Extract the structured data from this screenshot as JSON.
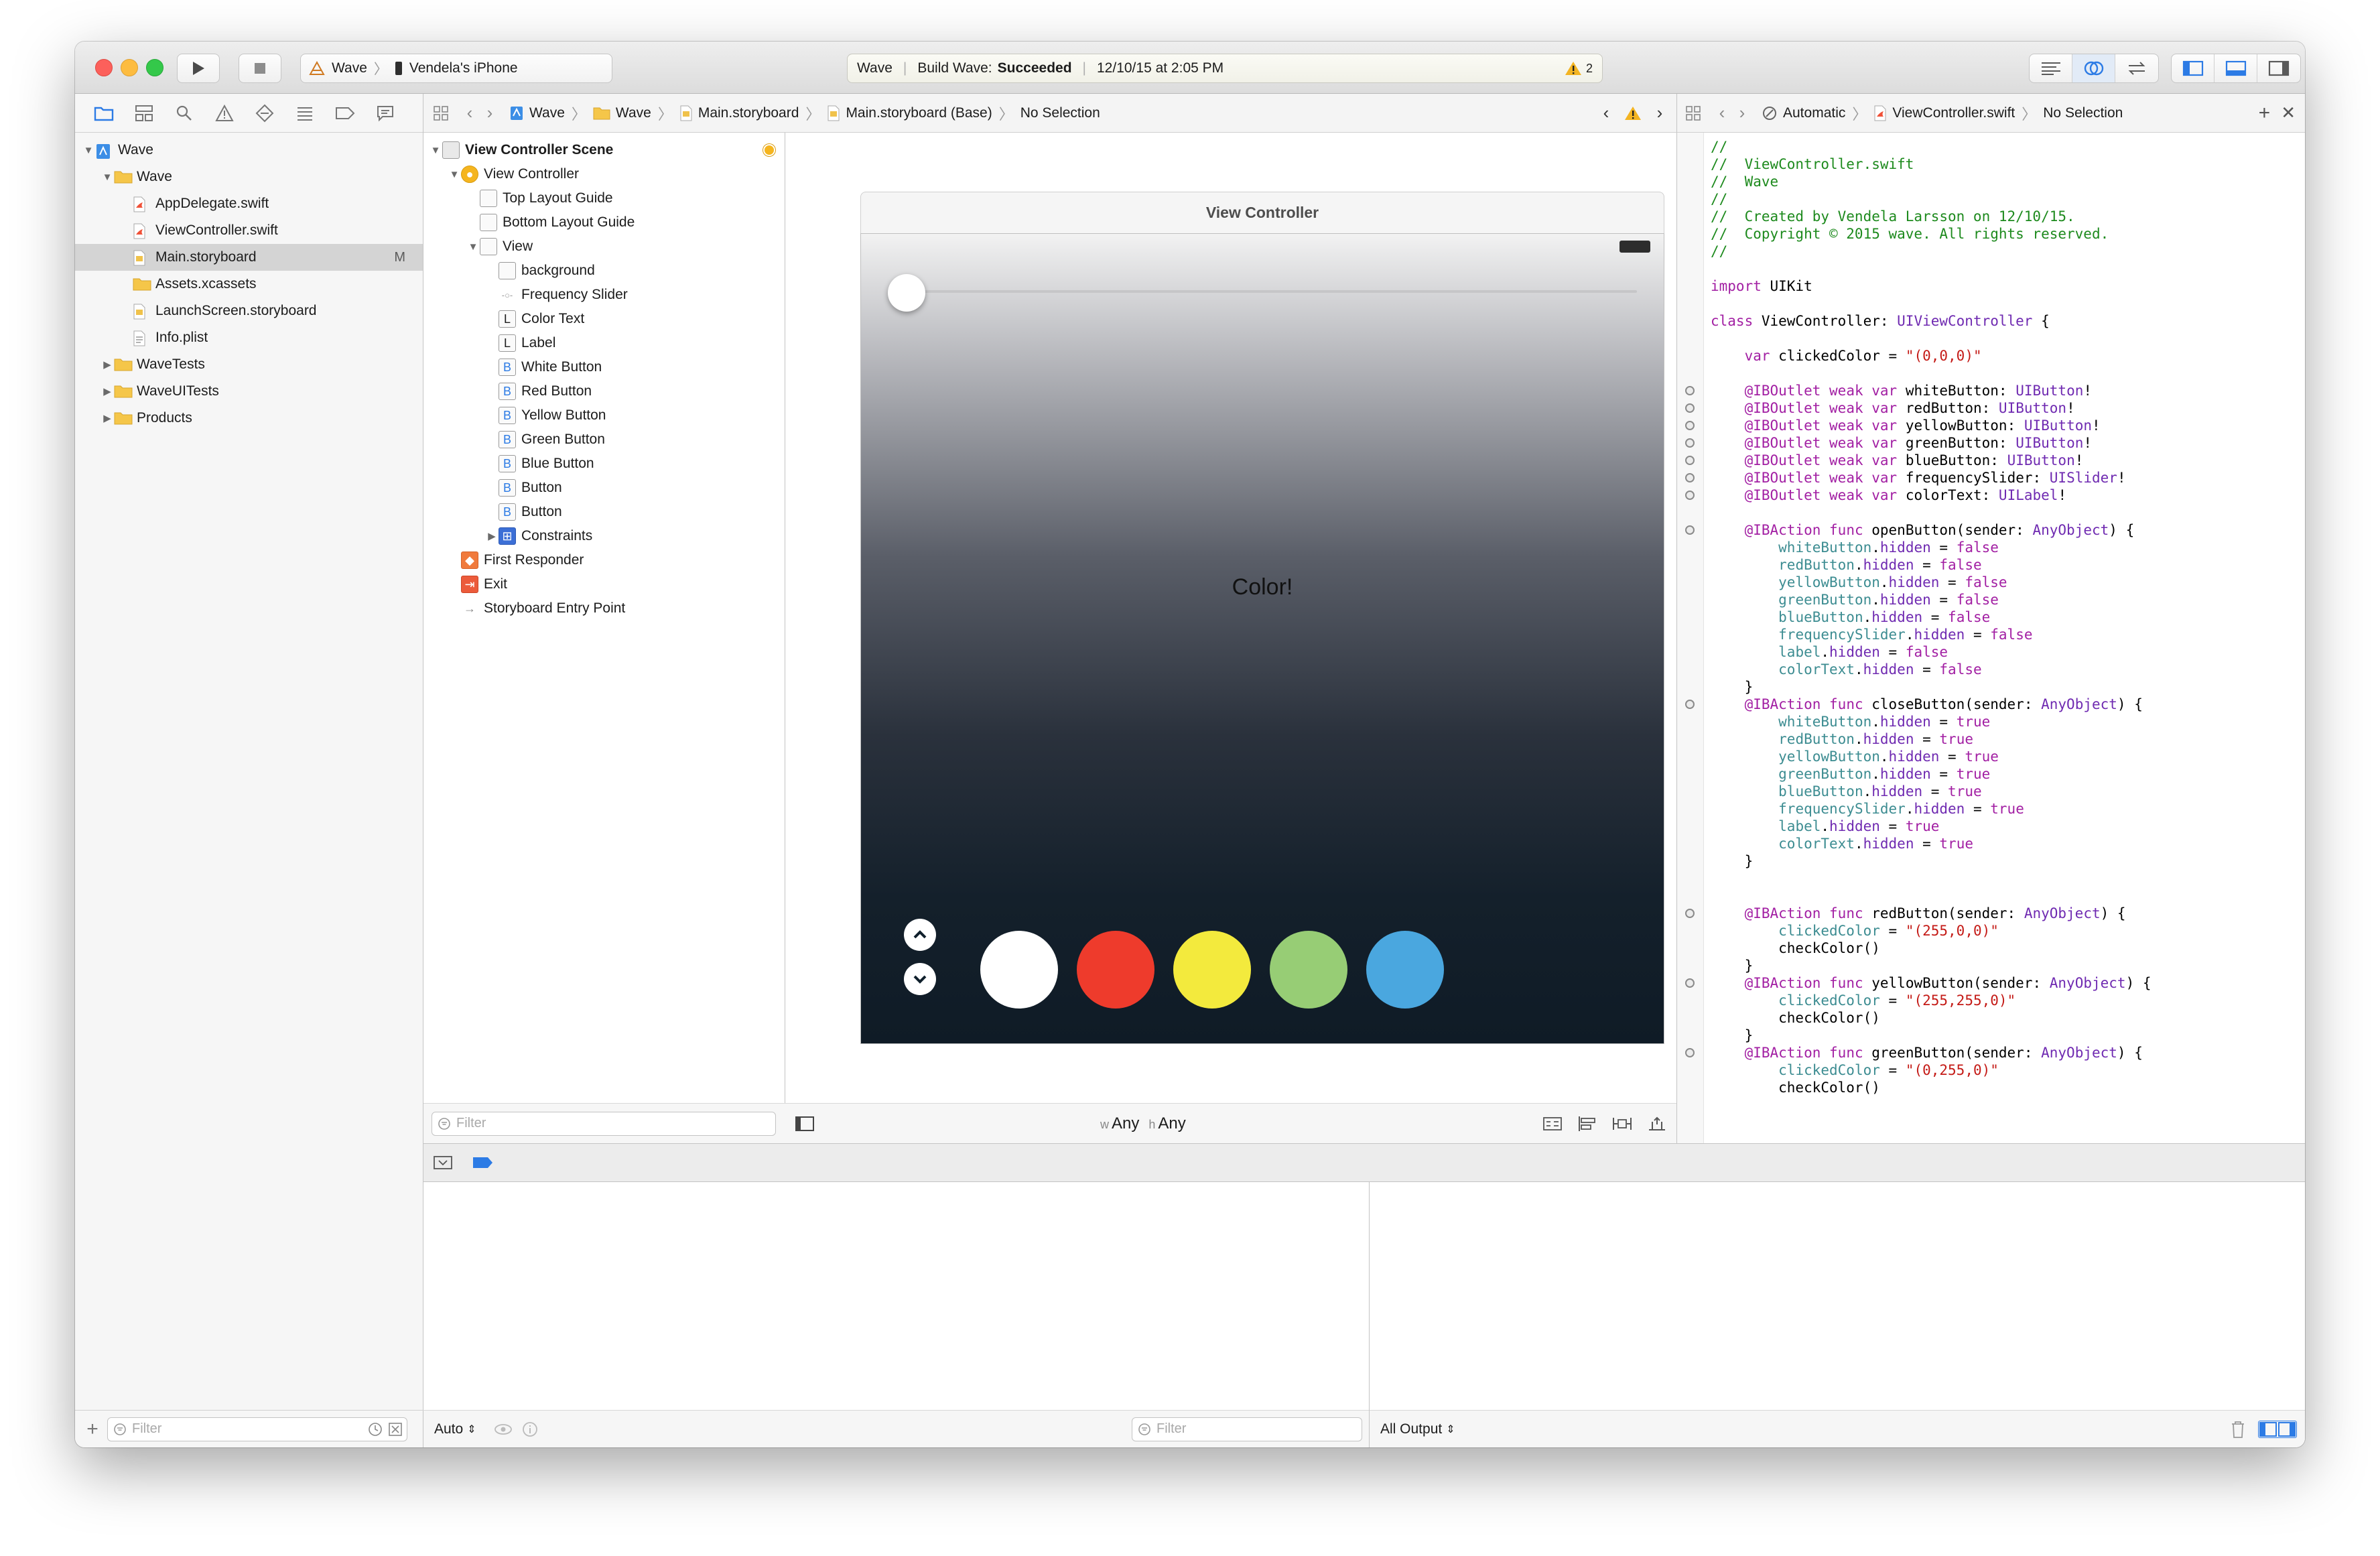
{
  "toolbar": {
    "scheme_project": "Wave",
    "scheme_device": "Vendela's iPhone",
    "activity_target": "Wave",
    "activity_status_prefix": "Build Wave:",
    "activity_status_result": "Succeeded",
    "activity_timestamp": "12/10/15 at 2:05 PM",
    "warning_count": "2"
  },
  "navigator": {
    "items": [
      {
        "label": "Wave",
        "indent": 0,
        "disclosure": "▼",
        "icon": "project-icon"
      },
      {
        "label": "Wave",
        "indent": 1,
        "disclosure": "▼",
        "icon": "folder-icon"
      },
      {
        "label": "AppDelegate.swift",
        "indent": 2,
        "disclosure": "",
        "icon": "swift-file-icon"
      },
      {
        "label": "ViewController.swift",
        "indent": 2,
        "disclosure": "",
        "icon": "swift-file-icon"
      },
      {
        "label": "Main.storyboard",
        "indent": 2,
        "disclosure": "",
        "icon": "storyboard-file-icon",
        "badge": "M",
        "selected": true
      },
      {
        "label": "Assets.xcassets",
        "indent": 2,
        "disclosure": "",
        "icon": "folder-icon"
      },
      {
        "label": "LaunchScreen.storyboard",
        "indent": 2,
        "disclosure": "",
        "icon": "storyboard-file-icon"
      },
      {
        "label": "Info.plist",
        "indent": 2,
        "disclosure": "",
        "icon": "plist-file-icon"
      },
      {
        "label": "WaveTests",
        "indent": 1,
        "disclosure": "▶",
        "icon": "folder-icon"
      },
      {
        "label": "WaveUITests",
        "indent": 1,
        "disclosure": "▶",
        "icon": "folder-icon"
      },
      {
        "label": "Products",
        "indent": 1,
        "disclosure": "▶",
        "icon": "folder-icon"
      }
    ],
    "filter_placeholder": "Filter"
  },
  "ib_jumpbar": {
    "crumbs": [
      "Wave",
      "Wave",
      "Main.storyboard",
      "Main.storyboard (Base)",
      "No Selection"
    ]
  },
  "editor_jumpbar": {
    "crumbs": [
      "Automatic",
      "ViewController.swift",
      "No Selection"
    ]
  },
  "outline": {
    "items": [
      {
        "label": "View Controller Scene",
        "indent": 0,
        "disclosure": "▼",
        "glyph": "",
        "bold": true
      },
      {
        "label": "View Controller",
        "indent": 1,
        "disclosure": "▼",
        "glyph": "●",
        "kind": "vc"
      },
      {
        "label": "Top Layout Guide",
        "indent": 2,
        "disclosure": "",
        "glyph": ""
      },
      {
        "label": "Bottom Layout Guide",
        "indent": 2,
        "disclosure": "",
        "glyph": ""
      },
      {
        "label": "View",
        "indent": 2,
        "disclosure": "▼",
        "glyph": ""
      },
      {
        "label": "background",
        "indent": 3,
        "disclosure": "",
        "glyph": ""
      },
      {
        "label": "Frequency Slider",
        "indent": 3,
        "disclosure": "",
        "glyph": "-○-"
      },
      {
        "label": "Color Text",
        "indent": 3,
        "disclosure": "",
        "glyph": "L"
      },
      {
        "label": "Label",
        "indent": 3,
        "disclosure": "",
        "glyph": "L"
      },
      {
        "label": "White Button",
        "indent": 3,
        "disclosure": "",
        "glyph": "B"
      },
      {
        "label": "Red Button",
        "indent": 3,
        "disclosure": "",
        "glyph": "B"
      },
      {
        "label": "Yellow Button",
        "indent": 3,
        "disclosure": "",
        "glyph": "B"
      },
      {
        "label": "Green Button",
        "indent": 3,
        "disclosure": "",
        "glyph": "B"
      },
      {
        "label": "Blue Button",
        "indent": 3,
        "disclosure": "",
        "glyph": "B"
      },
      {
        "label": "Button",
        "indent": 3,
        "disclosure": "",
        "glyph": "B"
      },
      {
        "label": "Button",
        "indent": 3,
        "disclosure": "",
        "glyph": "B"
      },
      {
        "label": "Constraints",
        "indent": 3,
        "disclosure": "▶",
        "glyph": "⊞",
        "kind": "constraints"
      },
      {
        "label": "First Responder",
        "indent": 1,
        "disclosure": "",
        "glyph": "◆",
        "kind": "responder"
      },
      {
        "label": "Exit",
        "indent": 1,
        "disclosure": "",
        "glyph": "⇥",
        "kind": "exit"
      },
      {
        "label": "Storyboard Entry Point",
        "indent": 1,
        "disclosure": "",
        "glyph": "→",
        "kind": "entry"
      }
    ],
    "filter_placeholder": "Filter"
  },
  "canvas": {
    "scene_title": "View Controller",
    "center_label": "Color!",
    "size_class_w_prefix": "w",
    "size_class_w": "Any",
    "size_class_h_prefix": "h",
    "size_class_h": "Any",
    "color_buttons": [
      {
        "name": "white",
        "color": "#ffffff"
      },
      {
        "name": "red",
        "color": "#ee3b2c"
      },
      {
        "name": "yellow",
        "color": "#f3ea3d"
      },
      {
        "name": "green",
        "color": "#97cd75"
      },
      {
        "name": "blue",
        "color": "#4aa7df"
      }
    ]
  },
  "code_lines": [
    [
      [
        "//",
        "comment"
      ]
    ],
    [
      [
        "//  ViewController.swift",
        "comment"
      ]
    ],
    [
      [
        "//  Wave",
        "comment"
      ]
    ],
    [
      [
        "//",
        "comment"
      ]
    ],
    [
      [
        "//  Created by Vendela Larsson on 12/10/15.",
        "comment"
      ]
    ],
    [
      [
        "//  Copyright © 2015 wave. All rights reserved.",
        "comment"
      ]
    ],
    [
      [
        "//",
        "comment"
      ]
    ],
    [],
    [
      [
        "import",
        "kw"
      ],
      [
        " UIKit",
        ""
      ]
    ],
    [],
    [
      [
        "class",
        "kw"
      ],
      [
        " ViewController: ",
        ""
      ],
      [
        "UIViewController",
        "type"
      ],
      [
        " {",
        ""
      ]
    ],
    [],
    [
      [
        "    ",
        ""
      ],
      [
        "var",
        "kw"
      ],
      [
        " clickedColor = ",
        ""
      ],
      [
        "\"(0,0,0)\"",
        "str"
      ]
    ],
    [],
    [
      [
        "    ",
        ""
      ],
      [
        "@IBOutlet",
        "kw"
      ],
      [
        " ",
        ""
      ],
      [
        "weak",
        "kw"
      ],
      [
        " ",
        ""
      ],
      [
        "var",
        "kw"
      ],
      [
        " whiteButton: ",
        ""
      ],
      [
        "UIButton",
        "type"
      ],
      [
        "!",
        ""
      ]
    ],
    [
      [
        "    ",
        ""
      ],
      [
        "@IBOutlet",
        "kw"
      ],
      [
        " ",
        ""
      ],
      [
        "weak",
        "kw"
      ],
      [
        " ",
        ""
      ],
      [
        "var",
        "kw"
      ],
      [
        " redButton: ",
        ""
      ],
      [
        "UIButton",
        "type"
      ],
      [
        "!",
        ""
      ]
    ],
    [
      [
        "    ",
        ""
      ],
      [
        "@IBOutlet",
        "kw"
      ],
      [
        " ",
        ""
      ],
      [
        "weak",
        "kw"
      ],
      [
        " ",
        ""
      ],
      [
        "var",
        "kw"
      ],
      [
        " yellowButton: ",
        ""
      ],
      [
        "UIButton",
        "type"
      ],
      [
        "!",
        ""
      ]
    ],
    [
      [
        "    ",
        ""
      ],
      [
        "@IBOutlet",
        "kw"
      ],
      [
        " ",
        ""
      ],
      [
        "weak",
        "kw"
      ],
      [
        " ",
        ""
      ],
      [
        "var",
        "kw"
      ],
      [
        " greenButton: ",
        ""
      ],
      [
        "UIButton",
        "type"
      ],
      [
        "!",
        ""
      ]
    ],
    [
      [
        "    ",
        ""
      ],
      [
        "@IBOutlet",
        "kw"
      ],
      [
        " ",
        ""
      ],
      [
        "weak",
        "kw"
      ],
      [
        " ",
        ""
      ],
      [
        "var",
        "kw"
      ],
      [
        " blueButton: ",
        ""
      ],
      [
        "UIButton",
        "type"
      ],
      [
        "!",
        ""
      ]
    ],
    [
      [
        "    ",
        ""
      ],
      [
        "@IBOutlet",
        "kw"
      ],
      [
        " ",
        ""
      ],
      [
        "weak",
        "kw"
      ],
      [
        " ",
        ""
      ],
      [
        "var",
        "kw"
      ],
      [
        " frequencySlider: ",
        ""
      ],
      [
        "UISlider",
        "type"
      ],
      [
        "!",
        ""
      ]
    ],
    [
      [
        "    ",
        ""
      ],
      [
        "@IBOutlet",
        "kw"
      ],
      [
        " ",
        ""
      ],
      [
        "weak",
        "kw"
      ],
      [
        " ",
        ""
      ],
      [
        "var",
        "kw"
      ],
      [
        " colorText: ",
        ""
      ],
      [
        "UILabel",
        "type"
      ],
      [
        "!",
        ""
      ]
    ],
    [],
    [
      [
        "    ",
        ""
      ],
      [
        "@IBAction",
        "kw"
      ],
      [
        " ",
        ""
      ],
      [
        "func",
        "kw"
      ],
      [
        " openButton(sender: ",
        ""
      ],
      [
        "AnyObject",
        "type"
      ],
      [
        ") {",
        ""
      ]
    ],
    [
      [
        "        ",
        ""
      ],
      [
        "whiteButton",
        "prop"
      ],
      [
        ".",
        ""
      ],
      [
        "hidden",
        "type"
      ],
      [
        " = ",
        ""
      ],
      [
        "false",
        "kw"
      ]
    ],
    [
      [
        "        ",
        ""
      ],
      [
        "redButton",
        "prop"
      ],
      [
        ".",
        ""
      ],
      [
        "hidden",
        "type"
      ],
      [
        " = ",
        ""
      ],
      [
        "false",
        "kw"
      ]
    ],
    [
      [
        "        ",
        ""
      ],
      [
        "yellowButton",
        "prop"
      ],
      [
        ".",
        ""
      ],
      [
        "hidden",
        "type"
      ],
      [
        " = ",
        ""
      ],
      [
        "false",
        "kw"
      ]
    ],
    [
      [
        "        ",
        ""
      ],
      [
        "greenButton",
        "prop"
      ],
      [
        ".",
        ""
      ],
      [
        "hidden",
        "type"
      ],
      [
        " = ",
        ""
      ],
      [
        "false",
        "kw"
      ]
    ],
    [
      [
        "        ",
        ""
      ],
      [
        "blueButton",
        "prop"
      ],
      [
        ".",
        ""
      ],
      [
        "hidden",
        "type"
      ],
      [
        " = ",
        ""
      ],
      [
        "false",
        "kw"
      ]
    ],
    [
      [
        "        ",
        ""
      ],
      [
        "frequencySlider",
        "prop"
      ],
      [
        ".",
        ""
      ],
      [
        "hidden",
        "type"
      ],
      [
        " = ",
        ""
      ],
      [
        "false",
        "kw"
      ]
    ],
    [
      [
        "        ",
        ""
      ],
      [
        "label",
        "prop"
      ],
      [
        ".",
        ""
      ],
      [
        "hidden",
        "type"
      ],
      [
        " = ",
        ""
      ],
      [
        "false",
        "kw"
      ]
    ],
    [
      [
        "        ",
        ""
      ],
      [
        "colorText",
        "prop"
      ],
      [
        ".",
        ""
      ],
      [
        "hidden",
        "type"
      ],
      [
        " = ",
        ""
      ],
      [
        "false",
        "kw"
      ]
    ],
    [
      [
        "    }",
        ""
      ]
    ],
    [
      [
        "    ",
        ""
      ],
      [
        "@IBAction",
        "kw"
      ],
      [
        " ",
        ""
      ],
      [
        "func",
        "kw"
      ],
      [
        " closeButton(sender: ",
        ""
      ],
      [
        "AnyObject",
        "type"
      ],
      [
        ") {",
        ""
      ]
    ],
    [
      [
        "        ",
        ""
      ],
      [
        "whiteButton",
        "prop"
      ],
      [
        ".",
        ""
      ],
      [
        "hidden",
        "type"
      ],
      [
        " = ",
        ""
      ],
      [
        "true",
        "kw"
      ]
    ],
    [
      [
        "        ",
        ""
      ],
      [
        "redButton",
        "prop"
      ],
      [
        ".",
        ""
      ],
      [
        "hidden",
        "type"
      ],
      [
        " = ",
        ""
      ],
      [
        "true",
        "kw"
      ]
    ],
    [
      [
        "        ",
        ""
      ],
      [
        "yellowButton",
        "prop"
      ],
      [
        ".",
        ""
      ],
      [
        "hidden",
        "type"
      ],
      [
        " = ",
        ""
      ],
      [
        "true",
        "kw"
      ]
    ],
    [
      [
        "        ",
        ""
      ],
      [
        "greenButton",
        "prop"
      ],
      [
        ".",
        ""
      ],
      [
        "hidden",
        "type"
      ],
      [
        " = ",
        ""
      ],
      [
        "true",
        "kw"
      ]
    ],
    [
      [
        "        ",
        ""
      ],
      [
        "blueButton",
        "prop"
      ],
      [
        ".",
        ""
      ],
      [
        "hidden",
        "type"
      ],
      [
        " = ",
        ""
      ],
      [
        "true",
        "kw"
      ]
    ],
    [
      [
        "        ",
        ""
      ],
      [
        "frequencySlider",
        "prop"
      ],
      [
        ".",
        ""
      ],
      [
        "hidden",
        "type"
      ],
      [
        " = ",
        ""
      ],
      [
        "true",
        "kw"
      ]
    ],
    [
      [
        "        ",
        ""
      ],
      [
        "label",
        "prop"
      ],
      [
        ".",
        ""
      ],
      [
        "hidden",
        "type"
      ],
      [
        " = ",
        ""
      ],
      [
        "true",
        "kw"
      ]
    ],
    [
      [
        "        ",
        ""
      ],
      [
        "colorText",
        "prop"
      ],
      [
        ".",
        ""
      ],
      [
        "hidden",
        "type"
      ],
      [
        " = ",
        ""
      ],
      [
        "true",
        "kw"
      ]
    ],
    [
      [
        "    }",
        ""
      ]
    ],
    [],
    [],
    [
      [
        "    ",
        ""
      ],
      [
        "@IBAction",
        "kw"
      ],
      [
        " ",
        ""
      ],
      [
        "func",
        "kw"
      ],
      [
        " redButton(sender: ",
        ""
      ],
      [
        "AnyObject",
        "type"
      ],
      [
        ") {",
        ""
      ]
    ],
    [
      [
        "        ",
        ""
      ],
      [
        "clickedColor",
        "prop"
      ],
      [
        " = ",
        ""
      ],
      [
        "\"(255,0,0)\"",
        "str"
      ]
    ],
    [
      [
        "        checkColor()",
        ""
      ]
    ],
    [
      [
        "    }",
        ""
      ]
    ],
    [
      [
        "    ",
        ""
      ],
      [
        "@IBAction",
        "kw"
      ],
      [
        " ",
        ""
      ],
      [
        "func",
        "kw"
      ],
      [
        " yellowButton(sender: ",
        ""
      ],
      [
        "AnyObject",
        "type"
      ],
      [
        ") {",
        ""
      ]
    ],
    [
      [
        "        ",
        ""
      ],
      [
        "clickedColor",
        "prop"
      ],
      [
        " = ",
        ""
      ],
      [
        "\"(255,255,0)\"",
        "str"
      ]
    ],
    [
      [
        "        checkColor()",
        ""
      ]
    ],
    [
      [
        "    }",
        ""
      ]
    ],
    [
      [
        "    ",
        ""
      ],
      [
        "@IBAction",
        "kw"
      ],
      [
        " ",
        ""
      ],
      [
        "func",
        "kw"
      ],
      [
        " greenButton(sender: ",
        ""
      ],
      [
        "AnyObject",
        "type"
      ],
      [
        ") {",
        ""
      ]
    ],
    [
      [
        "        ",
        ""
      ],
      [
        "clickedColor",
        "prop"
      ],
      [
        " = ",
        ""
      ],
      [
        "\"(0,255,0)\"",
        "str"
      ]
    ],
    [
      [
        "        checkColor()",
        ""
      ]
    ]
  ],
  "connection_lines": [
    14,
    15,
    16,
    17,
    18,
    19,
    20,
    22,
    32,
    44,
    48,
    52
  ],
  "debug": {
    "variables_mode": "Auto",
    "variables_filter_placeholder": "Filter",
    "console_mode": "All Output"
  }
}
